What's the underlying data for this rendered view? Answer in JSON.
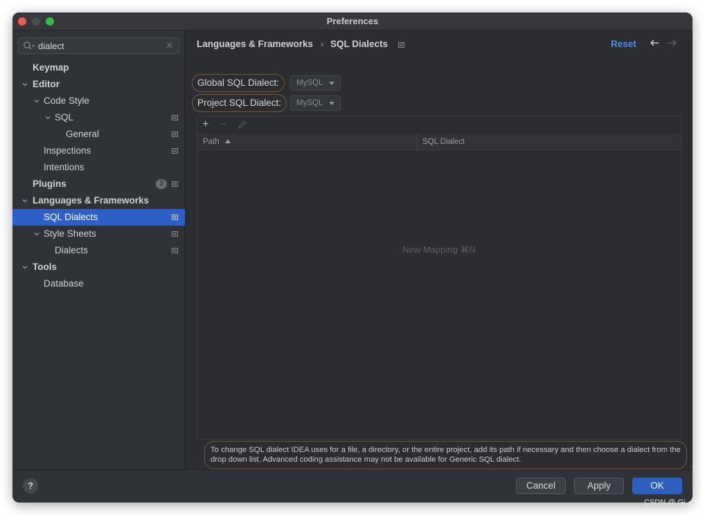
{
  "window": {
    "title": "Preferences"
  },
  "search": {
    "value": "dialect"
  },
  "tree": {
    "items": [
      {
        "label": "Keymap",
        "bold": true
      },
      {
        "label": "Editor",
        "bold": true
      },
      {
        "label": "Code Style"
      },
      {
        "label": "SQL"
      },
      {
        "label": "General"
      },
      {
        "label": "Inspections"
      },
      {
        "label": "Intentions"
      },
      {
        "label": "Plugins",
        "bold": true,
        "badge": "2"
      },
      {
        "label": "Languages & Frameworks",
        "bold": true
      },
      {
        "label": "SQL Dialects",
        "selected": true
      },
      {
        "label": "Style Sheets"
      },
      {
        "label": "Dialects"
      },
      {
        "label": "Tools",
        "bold": true
      },
      {
        "label": "Database"
      }
    ]
  },
  "breadcrumb": {
    "parent": "Languages & Frameworks",
    "separator": "›",
    "current": "SQL Dialects",
    "reset_label": "Reset"
  },
  "settings": {
    "global_label": "Global SQL Dialect:",
    "global_value": "MySQL",
    "project_label": "Project SQL Dialect:",
    "project_value": "MySQL"
  },
  "table": {
    "toolbar": {
      "add": "+",
      "remove": "−"
    },
    "columns": [
      "Path",
      "SQL Dialect"
    ],
    "empty_text": "New Mapping ⌘N"
  },
  "hint": {
    "text": "To change SQL dialect IDEA uses for a file, a directory, or the entire project, add its path if necessary and then choose a dialect from the drop down list. Advanced coding assistance may not be available for Generic SQL dialect."
  },
  "footer": {
    "help": "?",
    "cancel": "Cancel",
    "apply": "Apply",
    "ok": "OK"
  },
  "watermark": "CSDN @ Gi",
  "colors": {
    "accent": "#2e5fc7",
    "link": "#4a8ef0",
    "highlight_ring": "#7a5a33"
  }
}
